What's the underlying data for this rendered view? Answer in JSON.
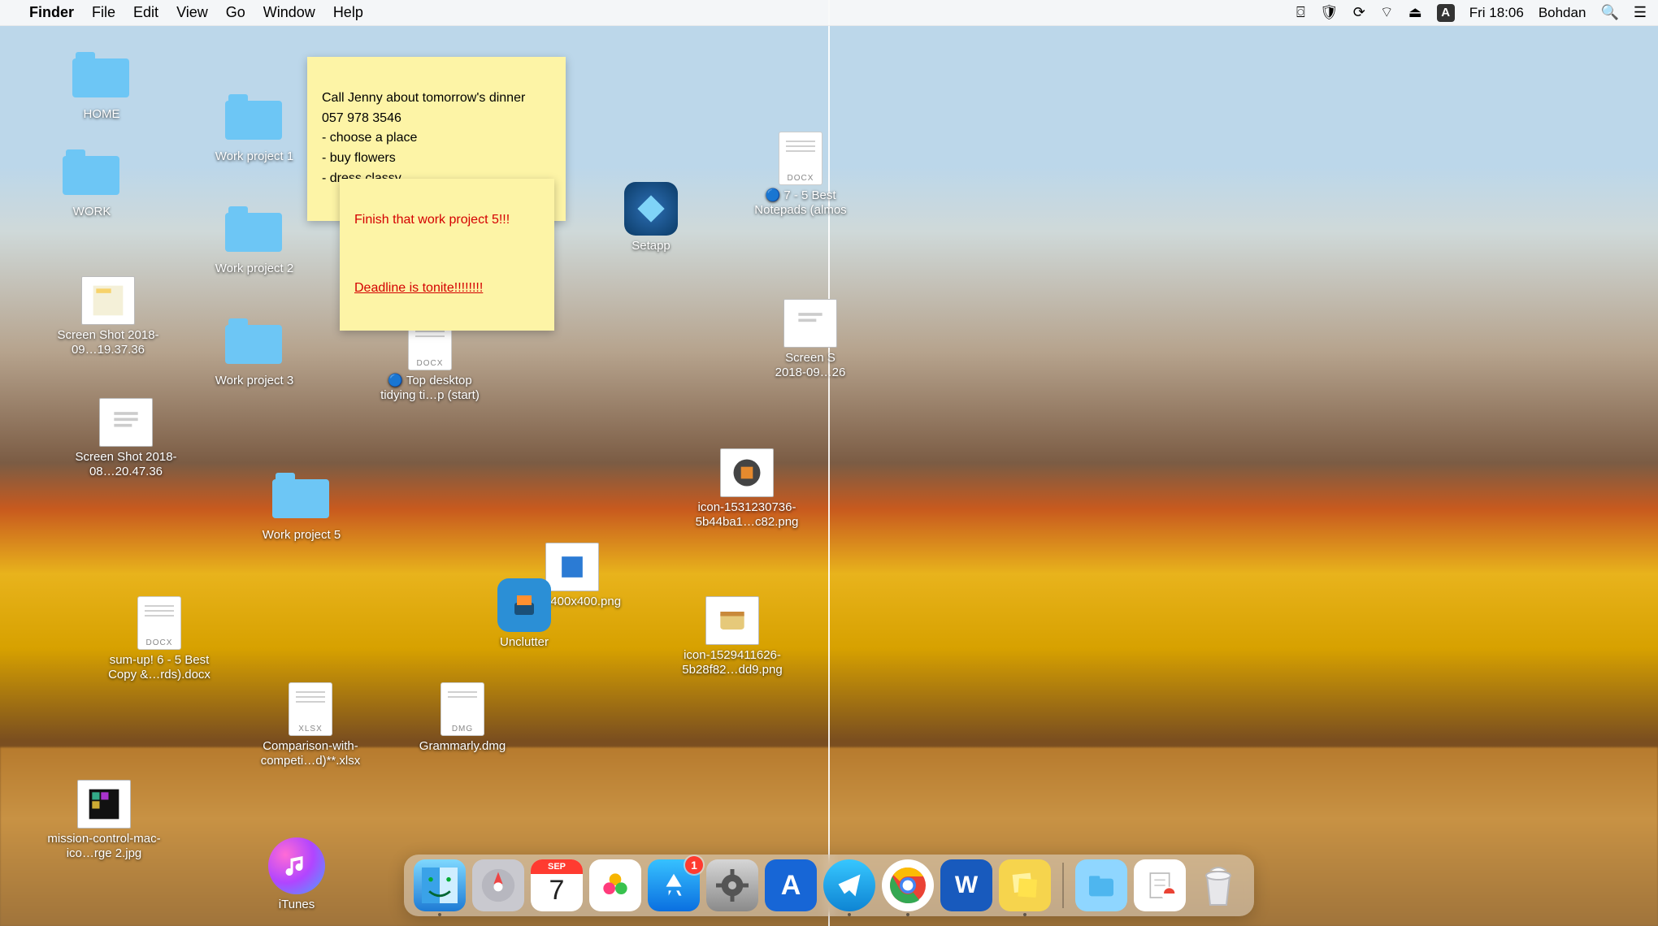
{
  "menubar": {
    "app": "Finder",
    "items": [
      "File",
      "Edit",
      "View",
      "Go",
      "Window",
      "Help"
    ],
    "clock": "Fri 18:06",
    "user": "Bohdan",
    "input_badge": "A"
  },
  "stickies": [
    {
      "text": "Call Jenny about tomorrow's dinner\n057 978 3546\n- choose a place\n- buy flowers\n- dress classy"
    },
    {
      "line1": "Finish that work project 5!!!",
      "line2": "Deadline is tonite!!!!!!!!"
    }
  ],
  "folders": {
    "home": "HOME",
    "work": "WORK",
    "wp1": "Work project 1",
    "wp2": "Work project 2",
    "wp3": "Work project 3",
    "wp5": "Work project 5"
  },
  "files": {
    "shot1": "Screen Shot 2018-09…19.37.36",
    "shot2": "Screen Shot 2018-08…20.47.36",
    "shot3": "Screen S 2018-09…26",
    "docx_sumup": "sum-up! 6 - 5 Best Copy &…rds).docx",
    "docx_tips": "🔵 Top desktop tidying ti…p (start)",
    "docx_notepads": "🔵 7 - 5 Best Notepads (almos",
    "xlsx_comp": "Comparison-with-competi…d)**.xlsx",
    "dmg_grammarly": "Grammarly.dmg",
    "png1": "icon-1531230736-5b44ba1…c82.png",
    "png2": "38a_400x400.png",
    "png3": "icon-1529411626-5b28f82…dd9.png",
    "mission": "mission-control-mac-ico…rge 2.jpg"
  },
  "apps_on_desk": {
    "setapp": "Setapp",
    "unclutter": "Unclutter"
  },
  "itunes_label": "iTunes",
  "dock": {
    "calendar_day": "7",
    "calendar_month": "SEP",
    "appstore_badge": "1",
    "items": [
      "finder",
      "launchpad",
      "calendar",
      "photos",
      "appstore",
      "preferences",
      "app-a",
      "telegram",
      "chrome",
      "word",
      "stickies"
    ],
    "right_items": [
      "downloads",
      "documents",
      "trash"
    ]
  }
}
